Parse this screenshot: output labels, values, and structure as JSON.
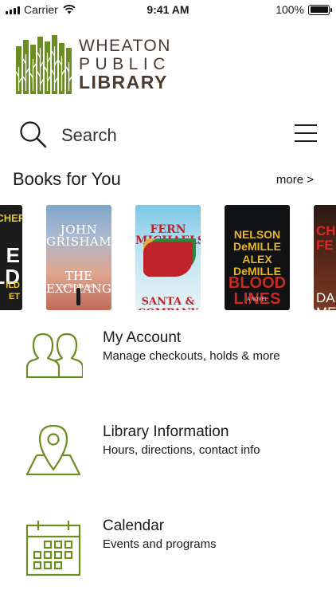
{
  "status_bar": {
    "carrier": "Carrier",
    "time": "9:41 AM",
    "battery_percent_label": "100%",
    "battery_level": 1.0
  },
  "logo": {
    "line1": "WHEATON",
    "line2": "PUBLIC",
    "line3": "LIBRARY",
    "colors": {
      "green": "#6b8e23",
      "brown": "#4a3a2f"
    }
  },
  "search": {
    "label": "Search"
  },
  "books_section": {
    "title": "Books for You",
    "more_label": "more >",
    "books": [
      {
        "author_text": "ACHER",
        "title_text": "E\nLD",
        "extra_text": "ILD\nET"
      },
      {
        "author_text": "JOHN\nGRISHAM",
        "title_text": "THE\nEXCHANGE",
        "extra_text": "AFTER THE FIRM"
      },
      {
        "author_text": "FERN\nMICHAELS",
        "title_text": "SANTA &\nCOMPANY",
        "extra_text": ""
      },
      {
        "author_text": "NELSON\nDeMILLE\nALEX DeMILLE",
        "title_text": "BLOOD\nLINES",
        "extra_text": "A NOVEL"
      },
      {
        "author_text": "CH\nFE",
        "title_text": "DA\nME",
        "extra_text": ""
      }
    ]
  },
  "menu": [
    {
      "title": "My Account",
      "subtitle": "Manage checkouts, holds & more",
      "icon": "users-icon"
    },
    {
      "title": "Library Information",
      "subtitle": "Hours, directions, contact info",
      "icon": "map-pin-icon"
    },
    {
      "title": "Calendar",
      "subtitle": "Events and programs",
      "icon": "calendar-icon"
    }
  ],
  "accent_color": "#6b8e23"
}
